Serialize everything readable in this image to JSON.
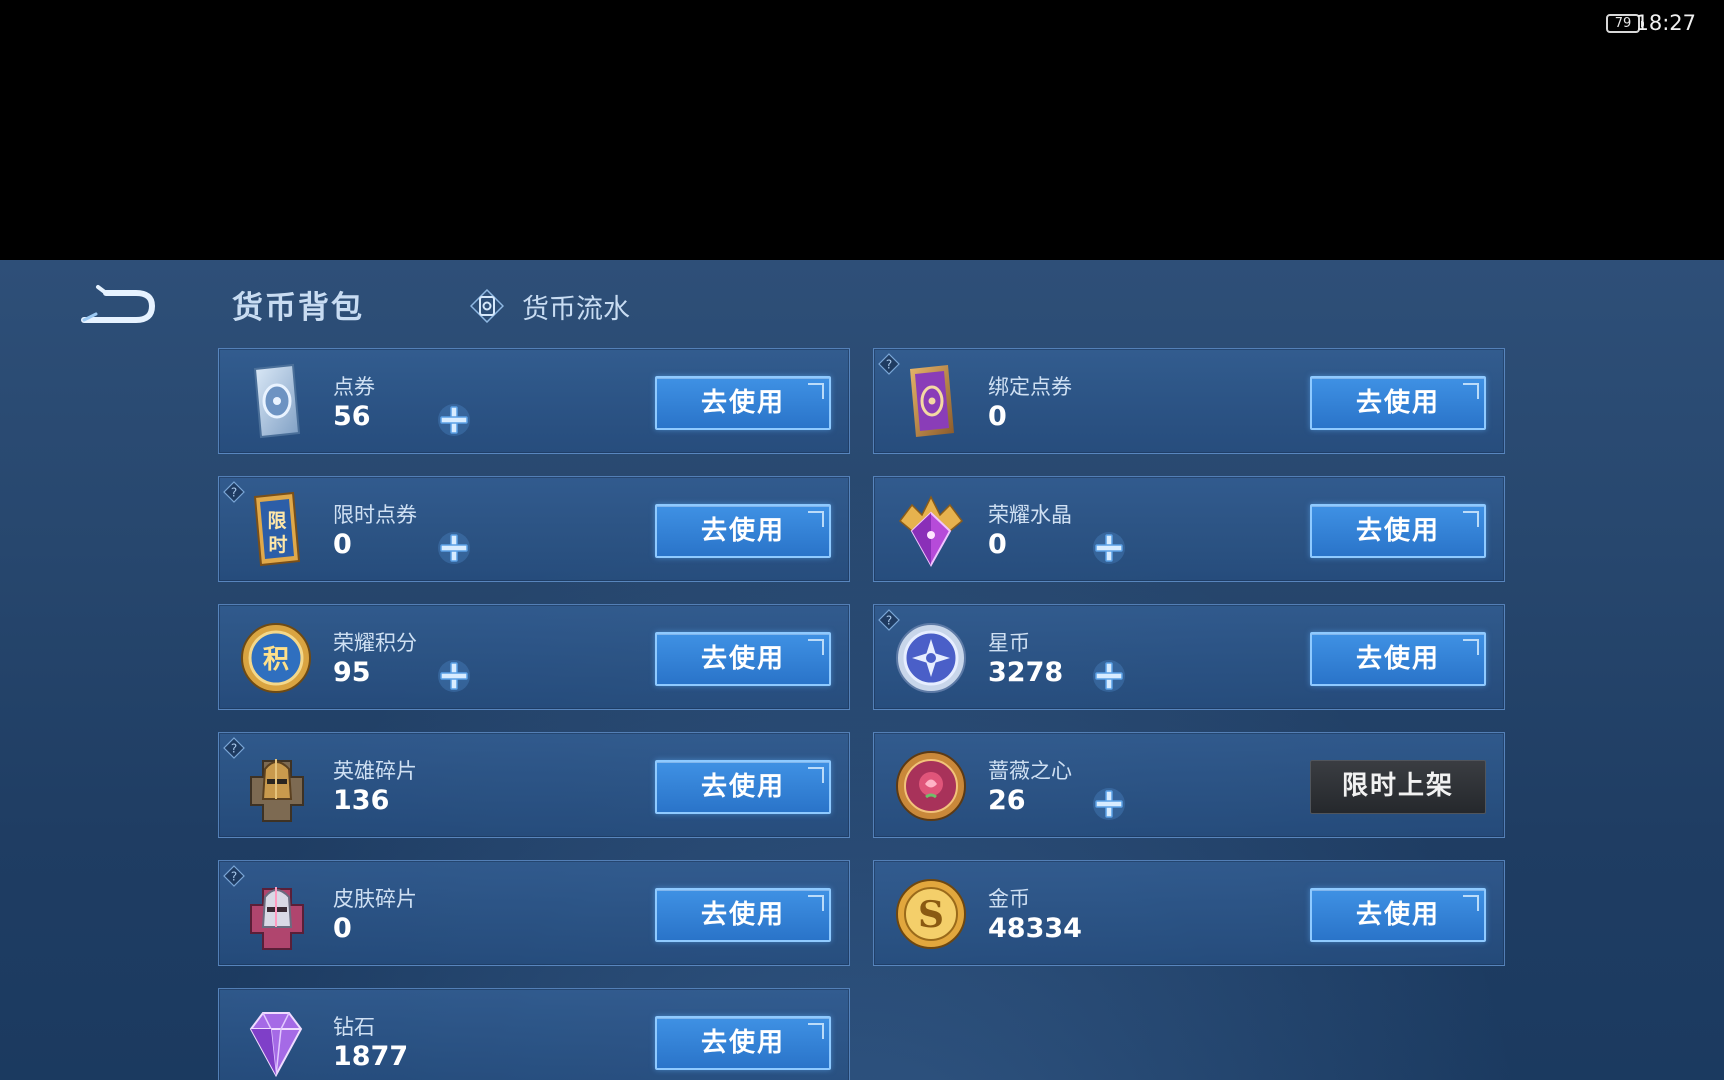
{
  "status_bar": {
    "battery": "79",
    "time": "18:27"
  },
  "header": {
    "title": "货币背包",
    "flow_tab": "货币流水"
  },
  "cards": [
    {
      "name": "点券",
      "value": "56",
      "button": "去使用",
      "icon": "coupon-icon",
      "plus": true,
      "help": false
    },
    {
      "name": "绑定点券",
      "value": "0",
      "button": "去使用",
      "icon": "bound-coupon-icon",
      "plus": false,
      "help": true
    },
    {
      "name": "限时点券",
      "value": "0",
      "button": "去使用",
      "icon": "limited-coupon-icon",
      "plus": true,
      "help": true
    },
    {
      "name": "荣耀水晶",
      "value": "0",
      "button": "去使用",
      "icon": "glory-crystal-icon",
      "plus": true,
      "help": false
    },
    {
      "name": "荣耀积分",
      "value": "95",
      "button": "去使用",
      "icon": "glory-points-icon",
      "plus": true,
      "help": false
    },
    {
      "name": "星币",
      "value": "3278",
      "button": "去使用",
      "icon": "star-coin-icon",
      "plus": true,
      "help": true
    },
    {
      "name": "英雄碎片",
      "value": "136",
      "button": "去使用",
      "icon": "hero-fragment-icon",
      "plus": false,
      "help": true
    },
    {
      "name": "蔷薇之心",
      "value": "26",
      "button": "限时上架",
      "icon": "rose-heart-icon",
      "plus": true,
      "help": false
    },
    {
      "name": "皮肤碎片",
      "value": "0",
      "button": "去使用",
      "icon": "skin-fragment-icon",
      "plus": false,
      "help": true
    },
    {
      "name": "金币",
      "value": "48334",
      "button": "去使用",
      "icon": "gold-coin-icon",
      "plus": false,
      "help": false
    },
    {
      "name": "钻石",
      "value": "1877",
      "button": "去使用",
      "icon": "diamond-icon",
      "plus": false,
      "help": false
    }
  ],
  "colors": {
    "primary_button": "#2f7fd6",
    "limited_button": "#2e3136",
    "panel": "#2e4f78"
  }
}
